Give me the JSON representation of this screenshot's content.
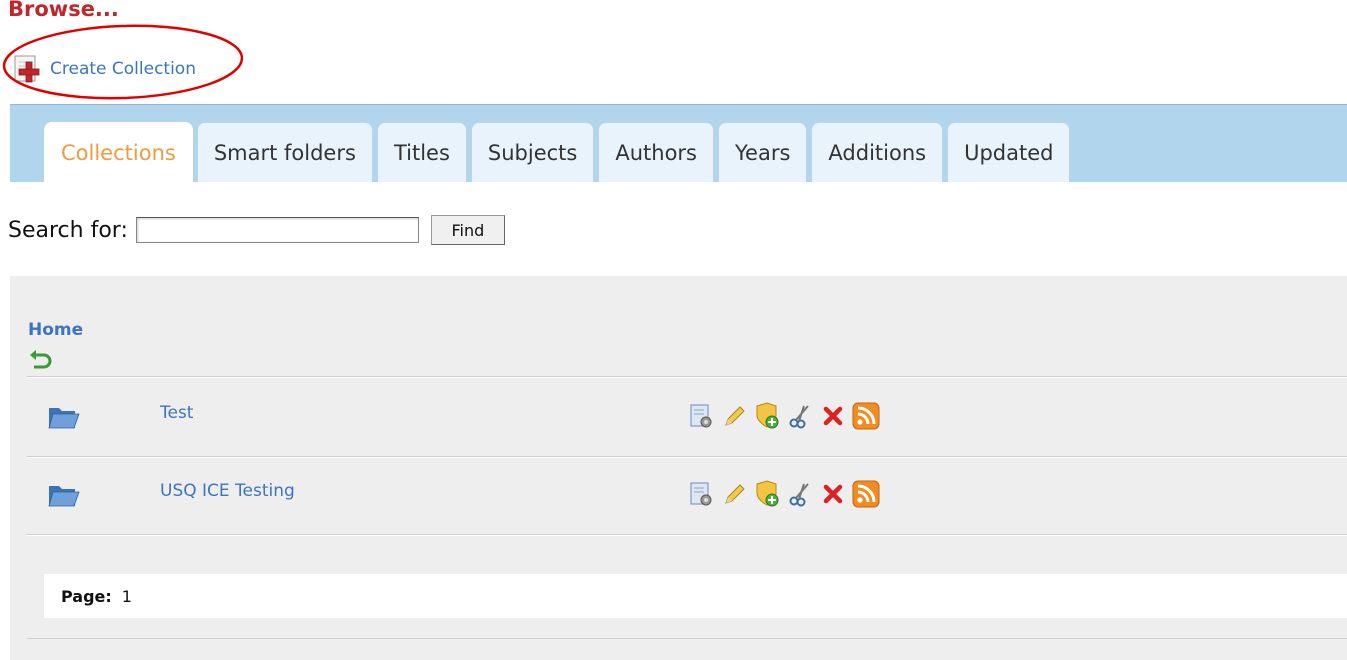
{
  "header": {
    "title": "Browse..."
  },
  "toolbar": {
    "create_label": "Create Collection"
  },
  "tabs": [
    {
      "label": "Collections",
      "active": true
    },
    {
      "label": "Smart folders"
    },
    {
      "label": "Titles"
    },
    {
      "label": "Subjects"
    },
    {
      "label": "Authors"
    },
    {
      "label": "Years"
    },
    {
      "label": "Additions"
    },
    {
      "label": "Updated"
    }
  ],
  "search": {
    "label": "Search for:",
    "value": "",
    "placeholder": "",
    "button_label": "Find"
  },
  "breadcrumb": {
    "home_label": "Home"
  },
  "collections": [
    {
      "name": "Test"
    },
    {
      "name": "USQ ICE Testing"
    }
  ],
  "row_actions": [
    "properties-icon",
    "edit-pencil-icon",
    "add-permission-shield-icon",
    "cut-scissors-icon",
    "delete-x-icon",
    "rss-feed-icon"
  ],
  "pagination": {
    "label": "Page:",
    "current": "1"
  },
  "colors": {
    "title_red": "#c0272d",
    "link_blue": "#3a75c4",
    "tab_bar_blue": "#b2d5ee",
    "active_tab_orange": "#f29a3e",
    "content_gray": "#eeeeee",
    "annotation_red": "#e00000"
  }
}
